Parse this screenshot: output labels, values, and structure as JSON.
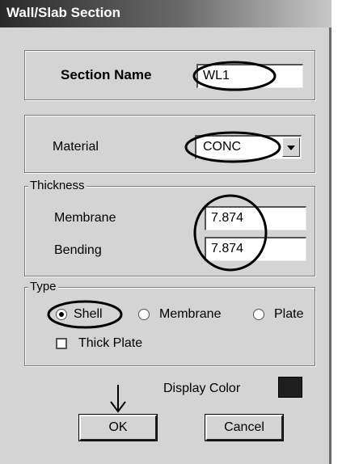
{
  "window": {
    "title": "Wall/Slab Section"
  },
  "section_name": {
    "label": "Section Name",
    "value": "WL1"
  },
  "material": {
    "label": "Material",
    "value": "CONC"
  },
  "thickness": {
    "legend": "Thickness",
    "membrane_label": "Membrane",
    "membrane_value": "7.874",
    "bending_label": "Bending",
    "bending_value": "7.874"
  },
  "type": {
    "legend": "Type",
    "options": [
      "Shell",
      "Membrane",
      "Plate"
    ],
    "selected": "Shell",
    "thick_plate_label": "Thick Plate",
    "thick_plate_checked": false
  },
  "display_color": {
    "label": "Display Color",
    "color": "#1e1e1e"
  },
  "buttons": {
    "ok": "OK",
    "cancel": "Cancel"
  }
}
